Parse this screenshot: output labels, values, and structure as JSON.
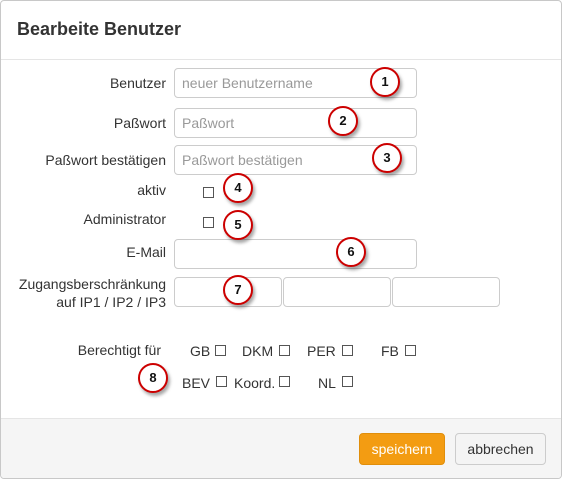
{
  "dialog": {
    "title": "Bearbeite Benutzer"
  },
  "form": {
    "username": {
      "label": "Benutzer",
      "placeholder": "neuer Benutzername",
      "value": ""
    },
    "password": {
      "label": "Paßwort",
      "placeholder": "Paßwort",
      "value": ""
    },
    "password_confirm": {
      "label": "Paßwort bestätigen",
      "placeholder": "Paßwort bestätigen",
      "value": ""
    },
    "active": {
      "label": "aktiv",
      "checked": false
    },
    "admin": {
      "label": "Administrator",
      "checked": false
    },
    "email": {
      "label": "E-Mail",
      "value": ""
    },
    "ip_restriction": {
      "label_line1": "Zugangsberschränkung",
      "label_line2": "auf IP1 / IP2 / IP3",
      "values": [
        "",
        "",
        ""
      ]
    },
    "permissions": {
      "label": "Berechtigt für",
      "items": [
        {
          "label": "GB",
          "checked": false
        },
        {
          "label": "DKM",
          "checked": false
        },
        {
          "label": "PER",
          "checked": false
        },
        {
          "label": "FB",
          "checked": false
        },
        {
          "label": "BEV",
          "checked": false
        },
        {
          "label": "Koord.",
          "checked": false
        },
        {
          "label": "NL",
          "checked": false
        }
      ]
    }
  },
  "markers": [
    "1",
    "2",
    "3",
    "4",
    "5",
    "6",
    "7",
    "8"
  ],
  "footer": {
    "save_label": "speichern",
    "cancel_label": "abbrechen"
  },
  "colors": {
    "save_button": "#f39c12",
    "marker_border": "#cc0000"
  }
}
